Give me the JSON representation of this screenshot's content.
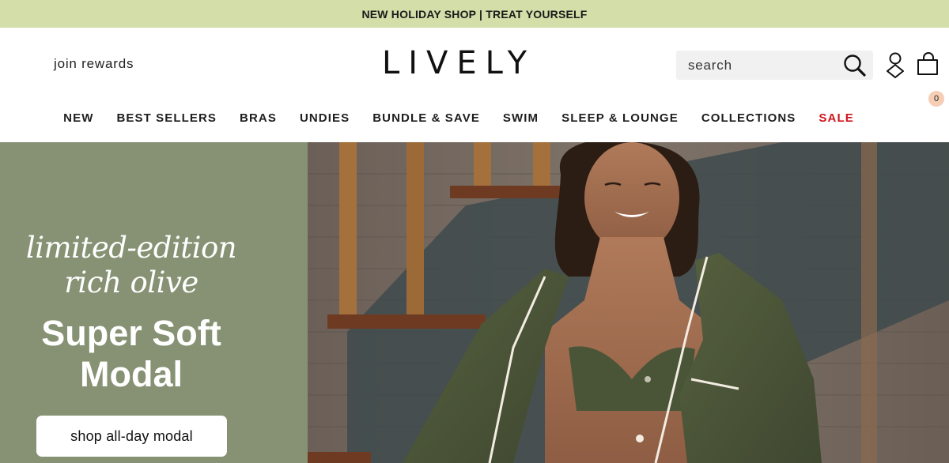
{
  "promo": {
    "text": "NEW HOLIDAY SHOP | TREAT YOURSELF"
  },
  "header": {
    "join_rewards": "join rewards",
    "logo": "LIVELY",
    "search": {
      "placeholder": "search",
      "value": ""
    },
    "cart_count": "0"
  },
  "nav": {
    "items": [
      {
        "label": "NEW"
      },
      {
        "label": "BEST SELLERS"
      },
      {
        "label": "BRAS"
      },
      {
        "label": "UNDIES"
      },
      {
        "label": "BUNDLE & SAVE"
      },
      {
        "label": "SWIM"
      },
      {
        "label": "SLEEP & LOUNGE"
      },
      {
        "label": "COLLECTIONS"
      },
      {
        "label": "SALE"
      }
    ]
  },
  "hero": {
    "tagline": "limited-edition rich olive",
    "title": "Super Soft Modal",
    "cta": "shop all-day modal"
  },
  "colors": {
    "promo_bg": "#d3dea9",
    "hero_panel": "#869273",
    "sale": "#d0141c",
    "cart_badge": "#f6cdb5"
  },
  "icons": {
    "search": "search-icon",
    "account": "account-icon",
    "cart": "shopping-bag-icon"
  }
}
